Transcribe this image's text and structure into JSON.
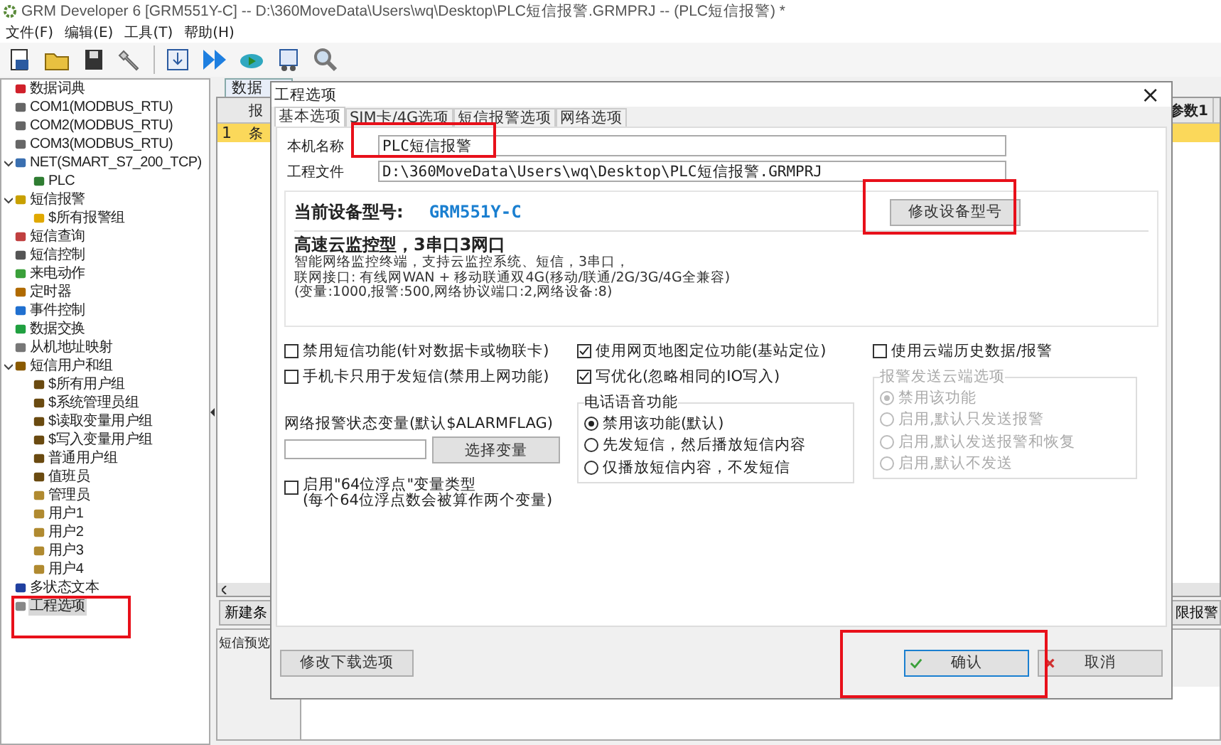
{
  "window": {
    "title": "GRM Developer 6 [GRM551Y-C]  -- D:\\360MoveData\\Users\\wq\\Desktop\\PLC短信报警.GRMPRJ -- (PLC短信报警) *"
  },
  "menu": [
    "文件(F)",
    "编辑(E)",
    "工具(T)",
    "帮助(H)"
  ],
  "tree": [
    {
      "label": "数据词典",
      "kind": "dict",
      "selected": false
    },
    {
      "label": "COM1(MODBUS_RTU)",
      "kind": "port",
      "selected": false
    },
    {
      "label": "COM2(MODBUS_RTU)",
      "kind": "port",
      "selected": false
    },
    {
      "label": "COM3(MODBUS_RTU)",
      "kind": "port",
      "selected": false
    },
    {
      "label": "NET(SMART_S7_200_TCP)",
      "kind": "net",
      "selected": false,
      "expanded": true,
      "children": [
        {
          "label": "PLC",
          "kind": "chip",
          "selected": false
        }
      ]
    },
    {
      "label": "短信报警",
      "kind": "bell",
      "selected": false,
      "expanded": true,
      "children": [
        {
          "label": "$所有报警组",
          "kind": "folder",
          "selected": false
        }
      ]
    },
    {
      "label": "短信查询",
      "kind": "query",
      "selected": false
    },
    {
      "label": "短信控制",
      "kind": "control",
      "selected": false
    },
    {
      "label": "来电动作",
      "kind": "phone",
      "selected": false
    },
    {
      "label": "定时器",
      "kind": "timer",
      "selected": false
    },
    {
      "label": "事件控制",
      "kind": "event",
      "selected": false
    },
    {
      "label": "数据交换",
      "kind": "exchange",
      "selected": false
    },
    {
      "label": "从机地址映射",
      "kind": "map",
      "selected": false
    },
    {
      "label": "短信用户和组",
      "kind": "users",
      "selected": false,
      "expanded": true,
      "children": [
        {
          "label": "$所有用户组",
          "kind": "group",
          "selected": false
        },
        {
          "label": "$系统管理员组",
          "kind": "group",
          "selected": false
        },
        {
          "label": "$读取变量用户组",
          "kind": "group",
          "selected": false
        },
        {
          "label": "$写入变量用户组",
          "kind": "group",
          "selected": false
        },
        {
          "label": "普通用户组",
          "kind": "group",
          "selected": false
        },
        {
          "label": "值班员",
          "kind": "group",
          "selected": false
        },
        {
          "label": "管理员",
          "kind": "user",
          "selected": false
        },
        {
          "label": "用户1",
          "kind": "user",
          "selected": false
        },
        {
          "label": "用户2",
          "kind": "user",
          "selected": false
        },
        {
          "label": "用户3",
          "kind": "user",
          "selected": false
        },
        {
          "label": "用户4",
          "kind": "user",
          "selected": false
        }
      ]
    },
    {
      "label": "多状态文本",
      "kind": "text",
      "selected": false
    },
    {
      "label": "工程选项",
      "kind": "wrench",
      "selected": true
    }
  ],
  "background": {
    "tab": "数据",
    "header_left": "报",
    "header_right": "参数1",
    "row_number": "1",
    "row_cell": "条",
    "left_button": "新建条",
    "right_button": "限报警",
    "preview_label": "短信预览"
  },
  "dialog": {
    "title": "工程选项",
    "close": "×",
    "tabs": [
      {
        "label": "基本选项",
        "selected": true
      },
      {
        "label": "SIM卡/4G选项",
        "selected": false
      },
      {
        "label": "短信报警选项",
        "selected": false
      },
      {
        "label": "网络选项",
        "selected": false
      }
    ],
    "fields": [
      {
        "label": "本机名称",
        "value": "PLC短信报警"
      },
      {
        "label": "工程文件",
        "value": "D:\\360MoveData\\Users\\wq\\Desktop\\PLC短信报警.GRMPRJ"
      }
    ],
    "device": {
      "label": "当前设备型号:",
      "model": "GRM551Y-C",
      "button": "修改设备型号",
      "heading": "高速云监控型，3串口3网口",
      "description": [
        "智能网络监控终端，支持云监控系统、短信，3串口，",
        "联网接口: 有线网WAN + 移动联通双4G(移动/联通/2G/3G/4G全兼容)",
        "(变量:1000,报警:500,网络协议端口:2,网络设备:8)"
      ]
    },
    "left_options": [
      {
        "label": "禁用短信功能(针对数据卡或物联卡)",
        "checked": false
      },
      {
        "label": "手机卡只用于发短信(禁用上网功能)",
        "checked": false
      }
    ],
    "alarm_variable": {
      "label": "网络报警状态变量(默认$ALARMFLAG)",
      "button": "选择变量"
    },
    "float_option": {
      "label": "启用\"64位浮点\"变量类型",
      "note": "(每个64位浮点数会被算作两个变量)",
      "checked": false
    },
    "middle_options": [
      {
        "label": "使用网页地图定位功能(基站定位)",
        "checked": true
      },
      {
        "label": "写优化(忽略相同的IO写入)",
        "checked": true
      }
    ],
    "voice": {
      "title": "电话语音功能",
      "disabled": false,
      "options": [
        {
          "label": "禁用该功能(默认)",
          "selected": true
        },
        {
          "label": "先发短信，然后播放短信内容",
          "selected": false
        },
        {
          "label": "仅播放短信内容，不发短信",
          "selected": false
        }
      ]
    },
    "cloud_option": {
      "label": "使用云端历史数据/报警",
      "checked": false
    },
    "cloud": {
      "title": "报警发送云端选项",
      "disabled": true,
      "options": [
        {
          "label": "禁用该功能",
          "selected": true
        },
        {
          "label": "启用,默认只发送报警",
          "selected": false
        },
        {
          "label": "启用,默认发送报警和恢复",
          "selected": false
        },
        {
          "label": "启用,默认不发送",
          "selected": false
        }
      ]
    },
    "footer": {
      "download_button": "修改下载选项",
      "ok": "确认",
      "cancel": "取消"
    }
  }
}
